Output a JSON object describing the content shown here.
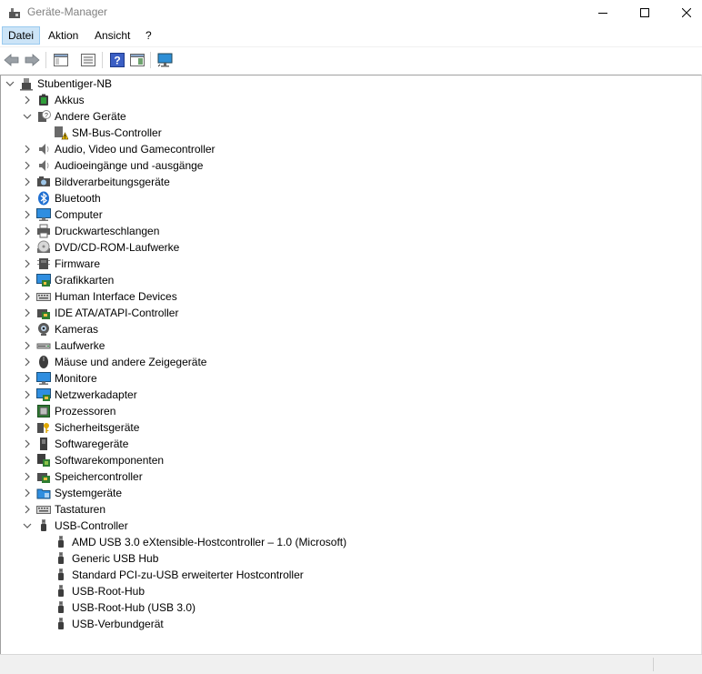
{
  "window": {
    "title": "Geräte-Manager"
  },
  "menu": [
    {
      "label": "Datei",
      "active": true
    },
    {
      "label": "Aktion",
      "active": false
    },
    {
      "label": "Ansicht",
      "active": false
    },
    {
      "label": "?",
      "active": false
    }
  ],
  "toolbar": {
    "buttons": [
      "back-icon",
      "forward-icon",
      "properties-pane-icon",
      "device-list-icon",
      "help-icon",
      "console-view-icon",
      "monitor-scan-icon"
    ]
  },
  "tree": {
    "root": {
      "label": "Stubentiger-NB",
      "icon": "computer-root",
      "expanded": true
    },
    "categories": [
      {
        "label": "Akkus",
        "icon": "battery",
        "expanded": false,
        "children": []
      },
      {
        "label": "Andere Geräte",
        "icon": "unknown-device",
        "expanded": true,
        "children": [
          {
            "label": "SM-Bus-Controller",
            "icon": "warning-device"
          }
        ]
      },
      {
        "label": "Audio, Video und Gamecontroller",
        "icon": "speaker",
        "expanded": false,
        "children": []
      },
      {
        "label": "Audioeingänge und -ausgänge",
        "icon": "speaker",
        "expanded": false,
        "children": []
      },
      {
        "label": "Bildverarbeitungsgeräte",
        "icon": "camera-imaging",
        "expanded": false,
        "children": []
      },
      {
        "label": "Bluetooth",
        "icon": "bluetooth",
        "expanded": false,
        "children": []
      },
      {
        "label": "Computer",
        "icon": "computer",
        "expanded": false,
        "children": []
      },
      {
        "label": "Druckwarteschlangen",
        "icon": "printer",
        "expanded": false,
        "children": []
      },
      {
        "label": "DVD/CD-ROM-Laufwerke",
        "icon": "disc",
        "expanded": false,
        "children": []
      },
      {
        "label": "Firmware",
        "icon": "chip",
        "expanded": false,
        "children": []
      },
      {
        "label": "Grafikkarten",
        "icon": "display-adapter",
        "expanded": false,
        "children": []
      },
      {
        "label": "Human Interface Devices",
        "icon": "keyboard",
        "expanded": false,
        "children": []
      },
      {
        "label": "IDE ATA/ATAPI-Controller",
        "icon": "storage-controller",
        "expanded": false,
        "children": []
      },
      {
        "label": "Kameras",
        "icon": "webcam",
        "expanded": false,
        "children": []
      },
      {
        "label": "Laufwerke",
        "icon": "disk-drive",
        "expanded": false,
        "children": []
      },
      {
        "label": "Mäuse und andere Zeigegeräte",
        "icon": "mouse",
        "expanded": false,
        "children": []
      },
      {
        "label": "Monitore",
        "icon": "monitor",
        "expanded": false,
        "children": []
      },
      {
        "label": "Netzwerkadapter",
        "icon": "network",
        "expanded": false,
        "children": []
      },
      {
        "label": "Prozessoren",
        "icon": "processor",
        "expanded": false,
        "children": []
      },
      {
        "label": "Sicherheitsgeräte",
        "icon": "security-key",
        "expanded": false,
        "children": []
      },
      {
        "label": "Softwaregeräte",
        "icon": "software-device",
        "expanded": false,
        "children": []
      },
      {
        "label": "Softwarekomponenten",
        "icon": "software-component",
        "expanded": false,
        "children": []
      },
      {
        "label": "Speichercontroller",
        "icon": "storage-controller",
        "expanded": false,
        "children": []
      },
      {
        "label": "Systemgeräte",
        "icon": "system-folder",
        "expanded": false,
        "children": []
      },
      {
        "label": "Tastaturen",
        "icon": "keyboard",
        "expanded": false,
        "children": []
      },
      {
        "label": "USB-Controller",
        "icon": "usb",
        "expanded": true,
        "children": [
          {
            "label": "AMD USB 3.0 eXtensible-Hostcontroller – 1.0 (Microsoft)",
            "icon": "usb"
          },
          {
            "label": "Generic USB Hub",
            "icon": "usb"
          },
          {
            "label": "Standard PCI-zu-USB erweiterter Hostcontroller",
            "icon": "usb"
          },
          {
            "label": "USB-Root-Hub",
            "icon": "usb"
          },
          {
            "label": "USB-Root-Hub (USB 3.0)",
            "icon": "usb"
          },
          {
            "label": "USB-Verbundgerät",
            "icon": "usb"
          }
        ]
      }
    ]
  },
  "colors": {
    "menu_active_bg": "#cce4f7",
    "menu_active_border": "#99c9ef",
    "title_text": "#808080",
    "chevron": "#5a5a5a"
  }
}
